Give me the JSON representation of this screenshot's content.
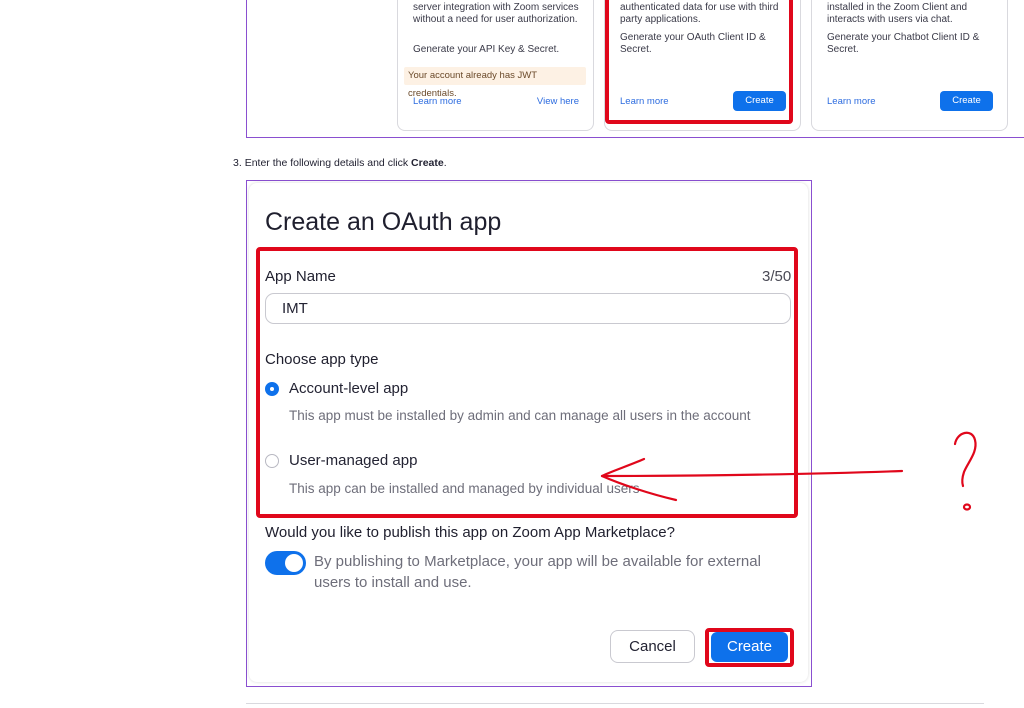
{
  "cards": [
    {
      "description": "Build an app that supports server-to-server integration with Zoom services without a need for user authorization.",
      "generate": "Generate your API Key & Secret.",
      "notice": "Your account already has JWT credentials.",
      "learn_more": "Learn more",
      "view_here": "View here"
    },
    {
      "description": "Build an app that accesses user-authenticated data for use with third party applications.",
      "generate": "Generate your OAuth Client ID & Secret.",
      "learn_more": "Learn more",
      "create_label": "Create"
    },
    {
      "description": "Build a Zoom chatbot that gets installed in the Zoom Client and interacts with users via chat.",
      "generate": "Generate your Chatbot Client ID & Secret.",
      "learn_more": "Learn more",
      "create_label": "Create"
    }
  ],
  "step": {
    "number": "3.",
    "text_before": "Enter the following details and click",
    "bold": "Create",
    "text_after": "."
  },
  "dialog": {
    "title": "Create an OAuth app",
    "app_name_label": "App Name",
    "app_name_counter": "3/50",
    "app_name_value": "IMT",
    "app_type_label": "Choose app type",
    "options": [
      {
        "label": "Account-level app",
        "description": "This app must be installed by admin and can manage all users in the account",
        "selected": true
      },
      {
        "label": "User-managed app",
        "description": "This app can be installed and managed by individual users",
        "selected": false
      }
    ],
    "publish_question": "Would you like to publish this app on Zoom App Marketplace?",
    "publish_enabled": true,
    "publish_description": "By publishing to Marketplace, your app will be available for external users to install and use.",
    "cancel_label": "Cancel",
    "create_label": "Create"
  },
  "annotation": {
    "question_mark": "?"
  },
  "colors": {
    "accent": "#0e71eb",
    "highlight": "#e0071b",
    "frame": "#8a4fd0"
  }
}
